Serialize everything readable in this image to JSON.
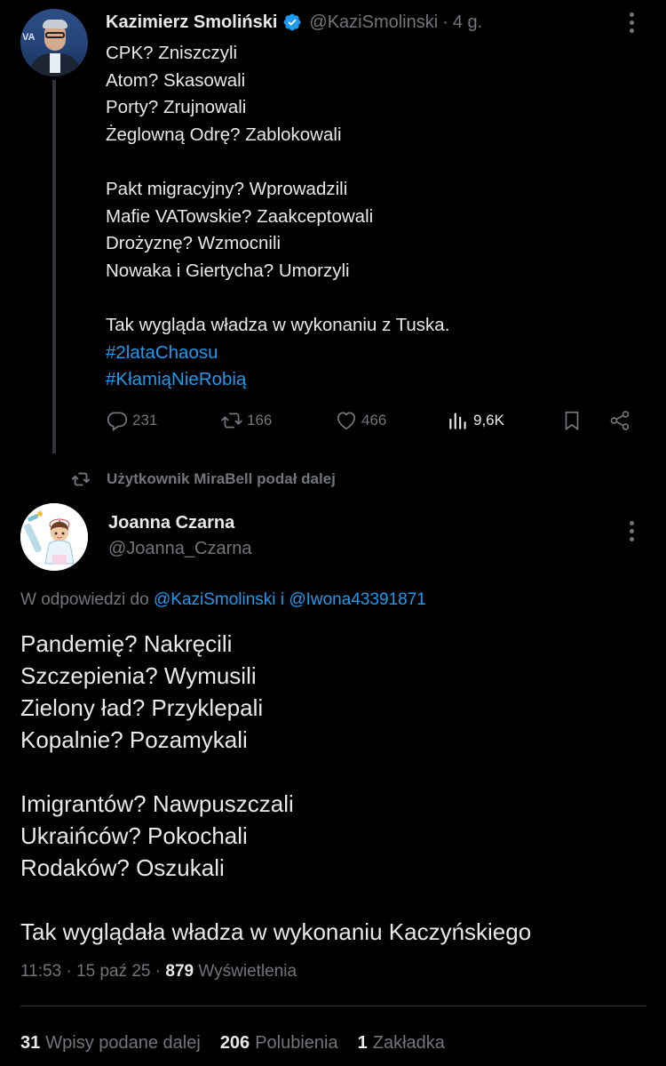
{
  "parent_tweet": {
    "author_name": "Kazimierz Smoliński",
    "handle": "@KaziSmolinski",
    "separator": "·",
    "time_ago": "4 g.",
    "avatar_text": "VA",
    "body_lines": [
      "CPK? Zniszczyli",
      "Atom? Skasowali",
      "Porty? Zrujnowali",
      "Żeglowną Odrę? Zablokowali",
      "",
      "Pakt migracyjny? Wprowadzili",
      "Mafie VATowskie? Zaakceptowali",
      "Drożyznę? Wzmocnili",
      "Nowaka i Giertycha? Umorzyli",
      "",
      "Tak wygląda władza w wykonaniu z Tuska."
    ],
    "hashtags": [
      "#2lataChaosu",
      "#KłamiąNieRobią"
    ],
    "actions": {
      "replies": "231",
      "reposts": "166",
      "likes": "466",
      "views": "9,6K"
    },
    "icons": [
      "verified-badge-icon",
      "reply-icon",
      "repost-icon",
      "like-icon",
      "views-icon",
      "bookmark-icon",
      "share-icon",
      "more-icon"
    ]
  },
  "repost_notice": {
    "text": "Użytkownik MiraBell podał dalej"
  },
  "reply_tweet": {
    "author_name": "Joanna Czarna",
    "handle": "@Joanna_Czarna",
    "reply_prefix": "W odpowiedzi do",
    "reply_mention_1": "@KaziSmolinski",
    "reply_joiner": "i",
    "reply_mention_2": "@Iwona43391871",
    "body_lines": [
      "Pandemię? Nakręcili",
      "Szczepienia? Wymusili",
      "Zielony ład? Przyklepali",
      "Kopalnie? Pozamykali",
      "",
      "Imigrantów? Nawpuszczali",
      "Ukraińców? Pokochali",
      "Rodaków? Oszukali",
      "",
      "Tak wyglądała władza w wykonaniu Kaczyńskiego"
    ],
    "time": "11:53",
    "date": "15 paź 25",
    "meta_separator": "·",
    "views_count": "879",
    "views_label": "Wyświetlenia",
    "stats": {
      "reposts_count": "31",
      "reposts_label": "Wpisy podane dalej",
      "likes_count": "206",
      "likes_label": "Polubienia",
      "bookmarks_count": "1",
      "bookmarks_label": "Zakładka"
    }
  },
  "colors": {
    "background": "#000000",
    "text_primary": "#e7e9ea",
    "text_secondary": "#71767b",
    "accent_link": "#1d9bf0",
    "divider": "#2f3336"
  }
}
